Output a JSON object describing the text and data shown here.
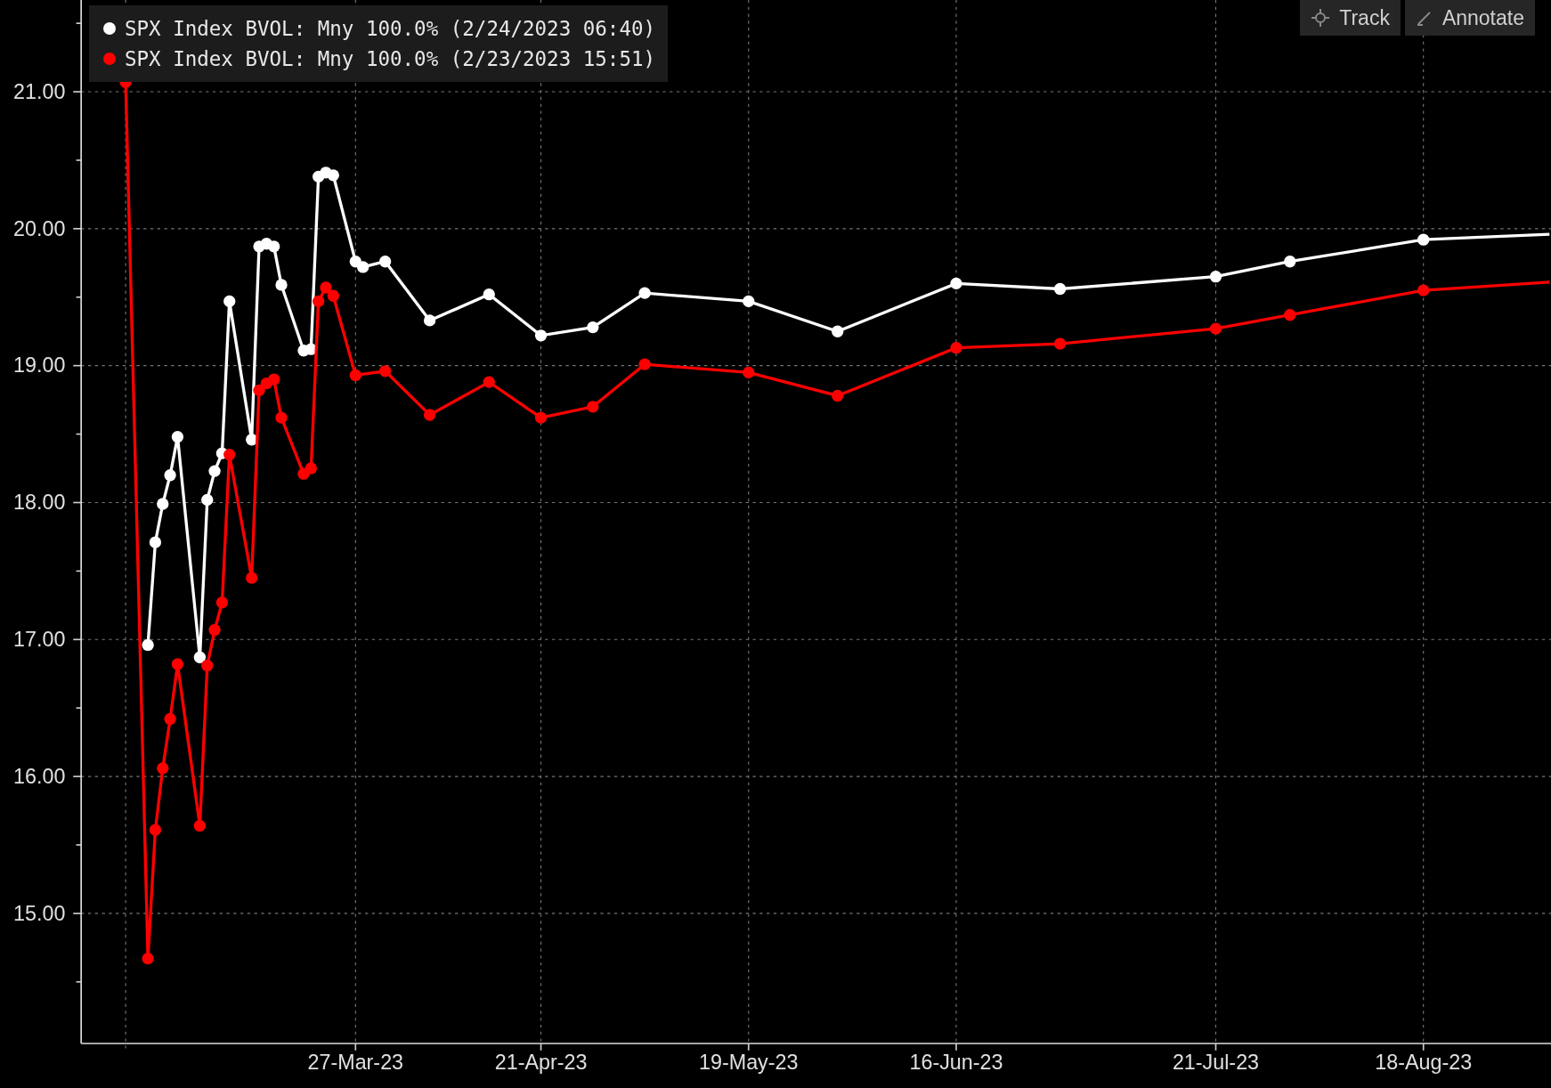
{
  "toolbar": {
    "buttons": [
      {
        "label": "Track",
        "kind": "track"
      },
      {
        "label": "Annotate",
        "kind": "annotate"
      }
    ]
  },
  "chart": {
    "chart_data": {
      "type": "line",
      "x": [
        "2023-02-24",
        "2023-02-27",
        "2023-02-28",
        "2023-03-01",
        "2023-03-02",
        "2023-03-03",
        "2023-03-06",
        "2023-03-07",
        "2023-03-08",
        "2023-03-09",
        "2023-03-10",
        "2023-03-13",
        "2023-03-14",
        "2023-03-15",
        "2023-03-16",
        "2023-03-17",
        "2023-03-20",
        "2023-03-21",
        "2023-03-22",
        "2023-03-23",
        "2023-03-24",
        "2023-03-27",
        "2023-03-28",
        "2023-03-31",
        "2023-04-06",
        "2023-04-14",
        "2023-04-21",
        "2023-04-28",
        "2023-05-05",
        "2023-05-19",
        "2023-05-31",
        "2023-06-16",
        "2023-06-30",
        "2023-07-21",
        "2023-07-31",
        "2023-08-18",
        "2023-09-04"
      ],
      "series": [
        {
          "name": "SPX Index BVOL: Mny 100.0% (2/24/2023 06:40)",
          "color": "#ffffff",
          "marker": "circle",
          "values": [
            null,
            16.96,
            17.71,
            17.99,
            18.2,
            18.48,
            16.87,
            18.02,
            18.23,
            18.36,
            19.47,
            18.46,
            19.87,
            19.89,
            19.87,
            19.59,
            19.11,
            19.12,
            20.38,
            20.41,
            20.39,
            19.76,
            19.72,
            19.76,
            19.33,
            19.52,
            19.22,
            19.28,
            19.53,
            19.47,
            19.25,
            19.6,
            19.56,
            19.65,
            19.76,
            19.92,
            19.96
          ]
        },
        {
          "name": "SPX Index BVOL: Mny 100.0% (2/23/2023 15:51)",
          "color": "#ff0000",
          "marker": "circle",
          "values": [
            21.07,
            14.67,
            15.61,
            16.06,
            16.42,
            16.82,
            15.64,
            16.81,
            17.07,
            17.27,
            18.35,
            17.45,
            18.82,
            18.87,
            18.9,
            18.62,
            18.21,
            18.25,
            19.47,
            19.57,
            19.51,
            18.93,
            null,
            18.96,
            18.64,
            18.88,
            18.62,
            18.7,
            19.01,
            18.95,
            18.78,
            19.13,
            19.16,
            19.27,
            19.37,
            19.55,
            19.61
          ]
        }
      ],
      "grid": true,
      "xlim": [
        "2023-02-18",
        "2023-09-04"
      ],
      "ylim": [
        14.05,
        21.67
      ],
      "xticks": [
        {
          "value": "2023-03-27",
          "label": "27-Mar-23"
        },
        {
          "value": "2023-04-21",
          "label": "21-Apr-23"
        },
        {
          "value": "2023-05-19",
          "label": "19-May-23"
        },
        {
          "value": "2023-06-16",
          "label": "16-Jun-23"
        },
        {
          "value": "2023-07-21",
          "label": "21-Jul-23"
        },
        {
          "value": "2023-08-18",
          "label": "18-Aug-23"
        }
      ],
      "yticks": [
        {
          "value": 15,
          "label": "15.00"
        },
        {
          "value": 16,
          "label": "16.00"
        },
        {
          "value": 17,
          "label": "17.00"
        },
        {
          "value": 18,
          "label": "18.00"
        },
        {
          "value": 19,
          "label": "19.00"
        },
        {
          "value": 20,
          "label": "20.00"
        },
        {
          "value": 21,
          "label": "21.00"
        }
      ]
    }
  }
}
